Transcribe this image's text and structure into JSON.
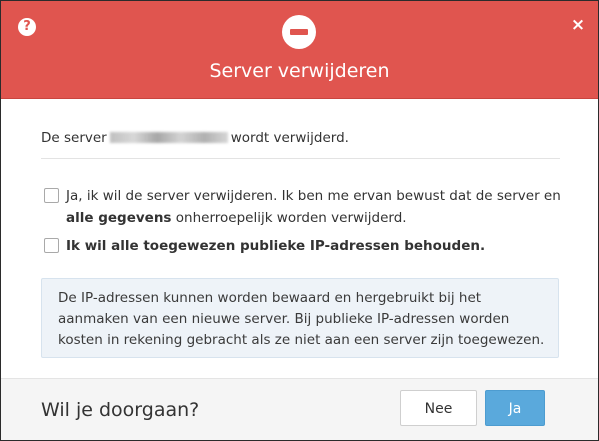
{
  "dialog": {
    "title": "Server verwijderen",
    "help_icon": "question-circle-icon",
    "close_icon": "close-icon",
    "close_glyph": "×",
    "help_glyph": "?",
    "header_icon": "minus-circle-icon",
    "accent_color": "#e0554f"
  },
  "body": {
    "message_prefix": "De server",
    "message_suffix": "wordt verwijderd.",
    "confirm_delete": {
      "text_start": "Ja, ik wil de server verwijderen. Ik ben me ervan bewust dat de server en",
      "text_bold": "alle gegevens",
      "text_end": "onherroepelijk worden verwijderd.",
      "checked": false
    },
    "keep_ips": {
      "label": "Ik wil alle toegewezen publieke IP-adressen behouden.",
      "checked": false
    },
    "info": "De IP-adressen kunnen worden bewaard en hergebruikt bij het aanmaken van een nieuwe server. Bij publieke IP-adressen worden kosten in rekening gebracht als ze niet aan een server zijn toegewezen."
  },
  "footer": {
    "question": "Wil je doorgaan?",
    "no_label": "Nee",
    "yes_label": "Ja",
    "yes_color": "#5aa9dc"
  }
}
